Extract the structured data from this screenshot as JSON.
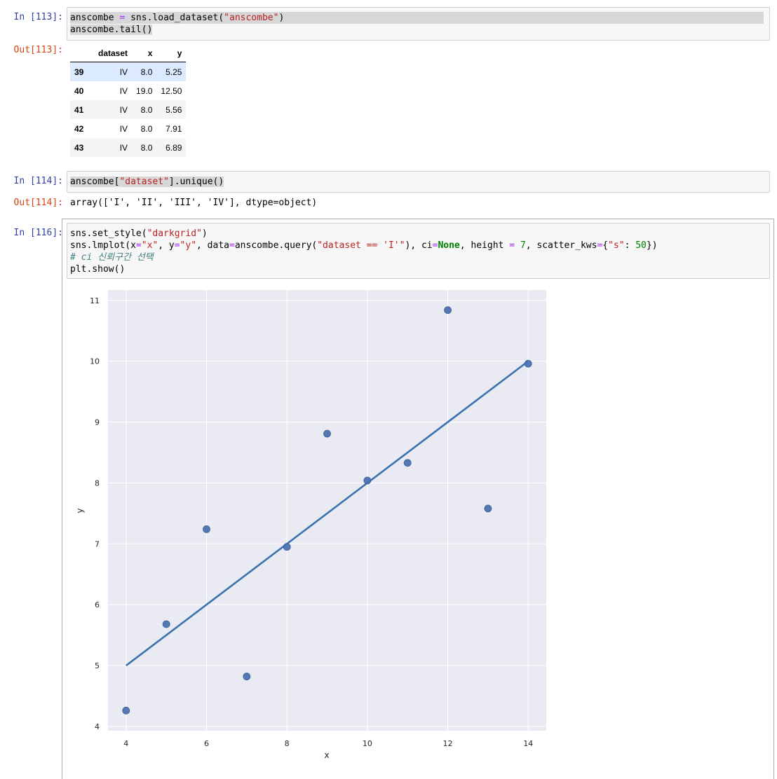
{
  "cells": [
    {
      "in_prompt": "In [113]:",
      "code_lines": [
        "anscombe = sns.load_dataset(\"anscombe\")",
        "anscombe.tail()"
      ],
      "out_prompt": "Out[113]:",
      "table": {
        "columns": [
          "dataset",
          "x",
          "y"
        ],
        "rows": [
          {
            "index": "39",
            "dataset": "IV",
            "x": "8.0",
            "y": "5.25"
          },
          {
            "index": "40",
            "dataset": "IV",
            "x": "19.0",
            "y": "12.50"
          },
          {
            "index": "41",
            "dataset": "IV",
            "x": "8.0",
            "y": "5.56"
          },
          {
            "index": "42",
            "dataset": "IV",
            "x": "8.0",
            "y": "7.91"
          },
          {
            "index": "43",
            "dataset": "IV",
            "x": "8.0",
            "y": "6.89"
          }
        ]
      }
    },
    {
      "in_prompt": "In [114]:",
      "code_lines": [
        "anscombe[\"dataset\"].unique()"
      ],
      "out_prompt": "Out[114]:",
      "output_text": "array(['I', 'II', 'III', 'IV'], dtype=object)"
    },
    {
      "in_prompt": "In [116]:",
      "code_lines": [
        "sns.set_style(\"darkgrid\")",
        "sns.lmplot(x=\"x\", y=\"y\", data=anscombe.query(\"dataset == 'I'\"), ci=None, height = 7, scatter_kws={\"s\": 50})",
        "# ci 신뢰구간 선택",
        "plt.show()"
      ]
    }
  ],
  "chart_data": {
    "type": "scatter",
    "xlabel": "x",
    "ylabel": "y",
    "xlim": [
      3.55,
      14.45
    ],
    "ylim": [
      3.93,
      11.17
    ],
    "xticks": [
      4,
      6,
      8,
      10,
      12,
      14
    ],
    "yticks": [
      4,
      5,
      6,
      7,
      8,
      9,
      10,
      11
    ],
    "grid": true,
    "points": [
      {
        "x": 10,
        "y": 8.04
      },
      {
        "x": 8,
        "y": 6.95
      },
      {
        "x": 13,
        "y": 7.58
      },
      {
        "x": 9,
        "y": 8.81
      },
      {
        "x": 11,
        "y": 8.33
      },
      {
        "x": 14,
        "y": 9.96
      },
      {
        "x": 6,
        "y": 7.24
      },
      {
        "x": 4,
        "y": 4.26
      },
      {
        "x": 12,
        "y": 10.84
      },
      {
        "x": 7,
        "y": 4.82
      },
      {
        "x": 5,
        "y": 5.68
      }
    ],
    "regression": {
      "x": [
        4,
        14
      ],
      "y": [
        5.0,
        10.0
      ]
    },
    "colors": {
      "point": "#4c72b0",
      "line": "#3a72b0",
      "background": "#eaeaf2",
      "grid": "#ffffff"
    }
  }
}
